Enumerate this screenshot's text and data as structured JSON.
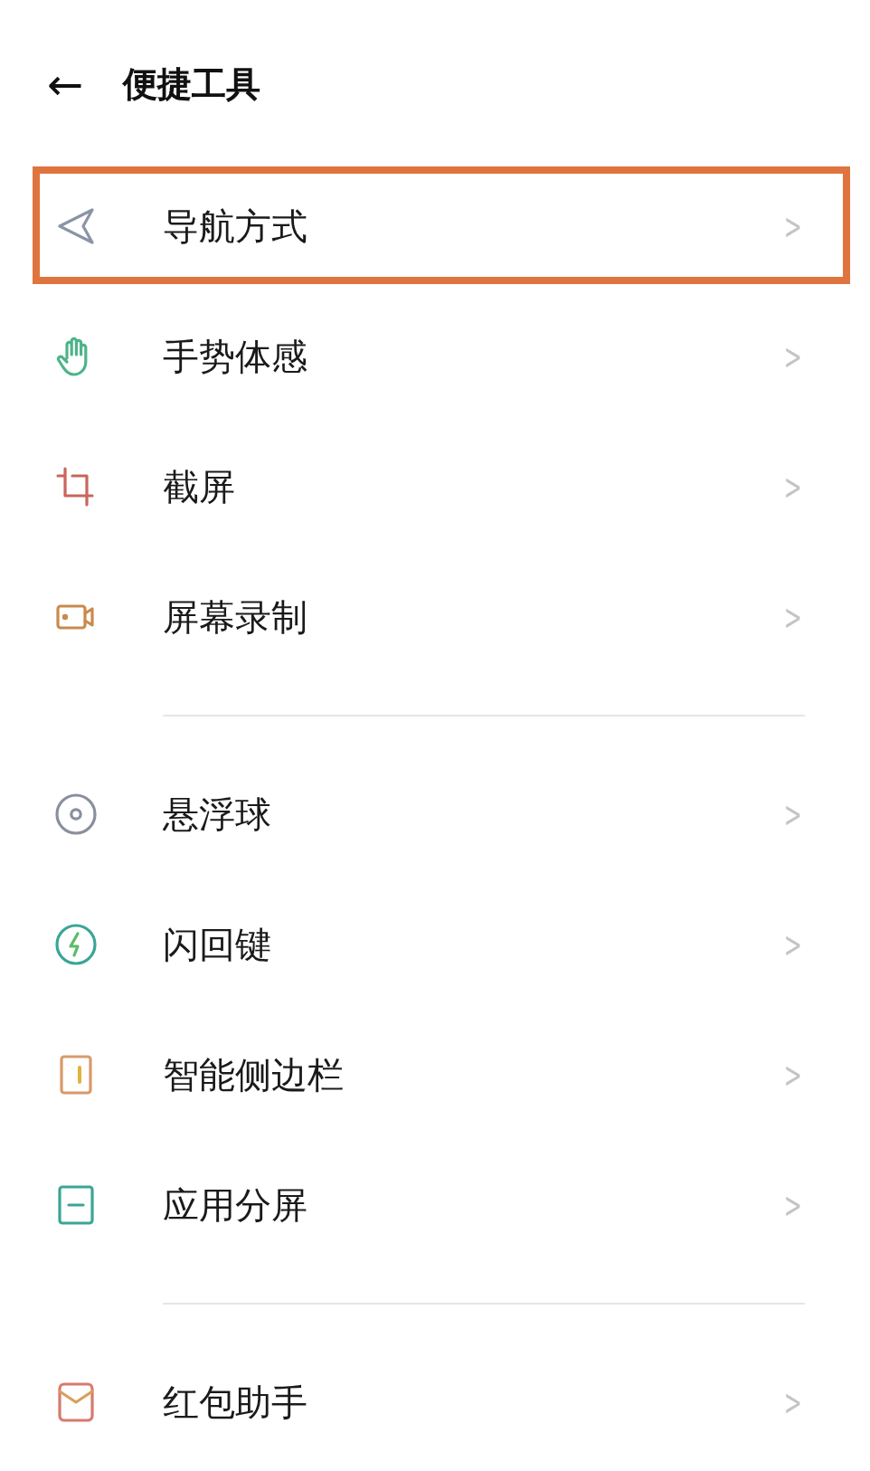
{
  "header": {
    "back": "←",
    "title": "便捷工具"
  },
  "sections": [
    {
      "items": [
        {
          "kind": "navigation",
          "label": "导航方式",
          "chevron": ">",
          "highlighted": true
        },
        {
          "kind": "gesture",
          "label": "手势体感",
          "chevron": ">",
          "highlighted": false
        },
        {
          "kind": "screenshot",
          "label": "截屏",
          "chevron": ">",
          "highlighted": false
        },
        {
          "kind": "record",
          "label": "屏幕录制",
          "chevron": ">",
          "highlighted": false
        }
      ]
    },
    {
      "items": [
        {
          "kind": "float",
          "label": "悬浮球",
          "chevron": ">",
          "highlighted": false
        },
        {
          "kind": "flash",
          "label": "闪回键",
          "chevron": ">",
          "highlighted": false
        },
        {
          "kind": "sidebar",
          "label": "智能侧边栏",
          "chevron": ">",
          "highlighted": false
        },
        {
          "kind": "split",
          "label": "应用分屏",
          "chevron": ">",
          "highlighted": false
        }
      ]
    },
    {
      "items": [
        {
          "kind": "envelope",
          "label": "红包助手",
          "chevron": ">",
          "highlighted": false
        }
      ]
    }
  ]
}
